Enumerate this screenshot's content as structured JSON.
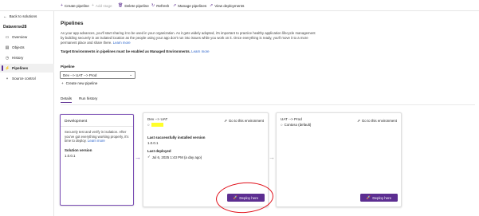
{
  "toolbar": {
    "create_pipeline": "Create pipeline",
    "add_stage": "Add stage",
    "delete_pipeline": "Delete pipeline",
    "refresh": "Refresh",
    "manage_pipelines": "Manage pipelines",
    "view_deployments": "View deployments"
  },
  "sidebar": {
    "back_label": "Back to solutions",
    "environment": "Dataverse28",
    "items": [
      {
        "label": "Overview",
        "icon": "overview-icon"
      },
      {
        "label": "Objects",
        "icon": "objects-icon"
      },
      {
        "label": "History",
        "icon": "history-icon"
      },
      {
        "label": "Pipelines",
        "icon": "pipelines-icon"
      },
      {
        "label": "Source control",
        "icon": "source-control-icon"
      }
    ],
    "active": "Pipelines"
  },
  "main": {
    "title": "Pipelines",
    "description": "As your app advances, you'll start sharing it to be used in your organization. As it gets widely adopted, it's important to practice healthy application lifecycle management by building securely in an isolated location as the people using your app don't run into issues while you work on it. Once everything is ready, you'll move it to a more permanent place and share there.",
    "description_link": "Learn more",
    "notice": "Target Environments in pipelines must be enabled as Managed Environments.",
    "notice_link": "Learn more",
    "pipeline_label": "Pipeline",
    "pipeline_value": "Dev --> UAT --> Prod",
    "new_pipeline": "Create new pipeline",
    "tabs": [
      "Details",
      "Run history"
    ]
  },
  "stages": {
    "dev": {
      "title": "Development",
      "body": "Securely test and verify in isolation. After you've got everything working properly, it's time to deploy.",
      "link": "Learn more",
      "version_label": "Solution version",
      "version": "1.0.0.1"
    },
    "uat": {
      "name": "Dev --> UAT",
      "goto": "Go to this environment",
      "installed_label": "Last successfully installed version",
      "installed_version": "1.0.0.1",
      "deployed_label": "Last deployed",
      "deployed_value": "Jul 6, 2025 1:43 PM (a day ago)",
      "deploy": "Deploy here"
    },
    "prod": {
      "name": "UAT --> Prod",
      "environment": "Contoso (default)",
      "goto": "Go to this environment",
      "deploy": "Deploy here"
    }
  },
  "colors": {
    "accent": "#5c2e91",
    "highlight": "#ffff2a",
    "annotation": "#e0101a"
  }
}
